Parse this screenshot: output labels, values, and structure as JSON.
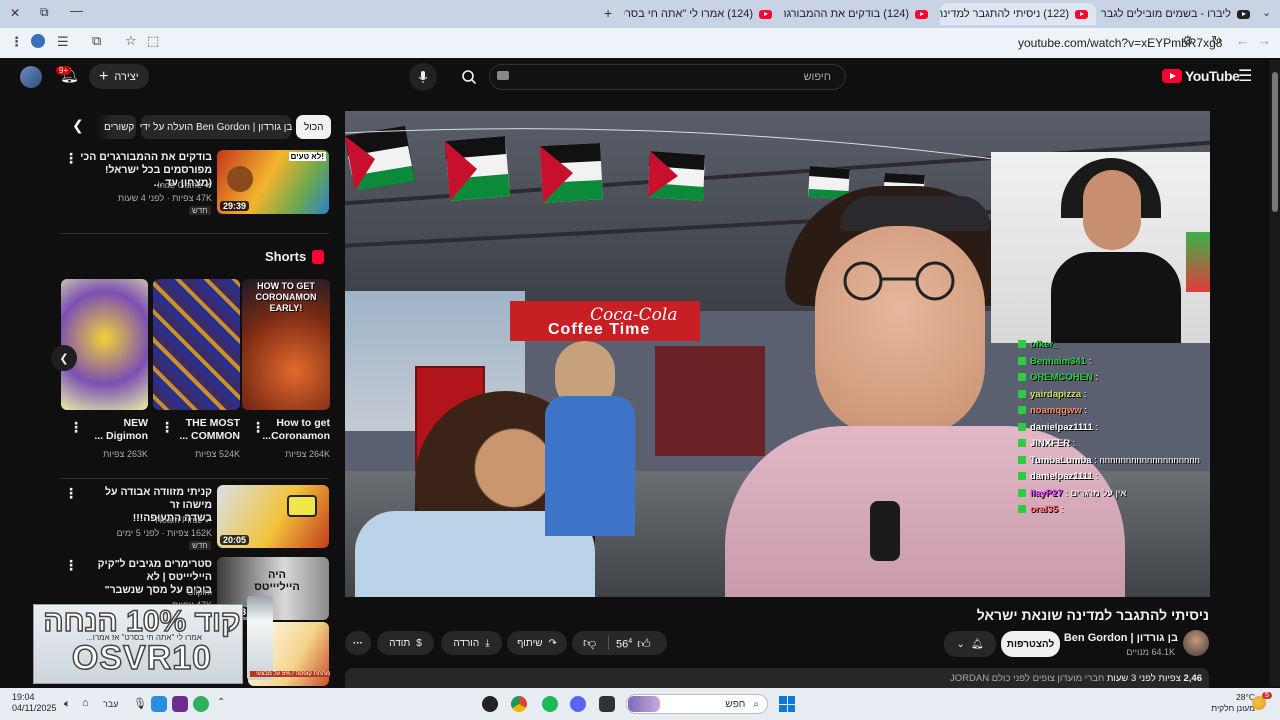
{
  "browser": {
    "tabs": [
      {
        "label": "ליברו - בשמים מובילים לגבר ול..."
      },
      {
        "label": "(122) ניסיתי להתגבר למדינה ש..."
      },
      {
        "label": "(124) בודקים את ההמבורגרים..."
      },
      {
        "label": "(124) אמרו לי \"אתה חי בסרט\"..."
      }
    ],
    "url": "youtube.com/watch?v=xEYPmbR7xg8"
  },
  "header": {
    "logo": "YouTube",
    "search_placeholder": "חיפוש",
    "create_label": "יצירה",
    "notif_count": "9+"
  },
  "filters": [
    "הכול",
    "הועלה על ידי Ben Gordon | בן גורדון",
    "קשורים"
  ],
  "sidebar": {
    "top_video": {
      "title_line1": "בודקים את ההמבורגרים הכי",
      "title_line2": "מפורסמים בכל ישראל! (מצחון עד ...",
      "channel": "Inde Game",
      "meta": "47K צפיות · לפני 4 שעות",
      "badge": "חדש",
      "duration": "29:39",
      "thumb_text": "לא טעים!"
    },
    "shorts_heading": "Shorts",
    "shorts": [
      {
        "title_line1": "How to get",
        "title_line2": "Coronamon...",
        "views": "264K צפיות",
        "thumb_text": "HOW TO GET CORONAMON EARLY!"
      },
      {
        "title_line1": "THE MOST",
        "title_line2": "COMMON ...",
        "views": "524K צפיות"
      },
      {
        "title_line1": "NEW",
        "title_line2": "Digimon ...",
        "views": "263K צפיות"
      }
    ],
    "video2": {
      "title_line1": "קניתי מזוודה אבודה על מישהו זר",
      "title_line2": "בשדה התעופה!!!",
      "channel": "Noam Firuz",
      "meta": "162K צפיות · לפני 5 ימים",
      "badge": "חדש",
      "duration": "20:05"
    },
    "video3": {
      "title_line1": "סטרימרים מגיבים ל\"קיק הייליייטס | לא",
      "title_line2": "בוכים על מסך שנשבר\"",
      "channel": "Clipim",
      "meta": "47K צפיות",
      "duration": "17:08",
      "thumb_text": "היה הייליייטס"
    }
  },
  "ad_overlay": {
    "line1": "קוד 10% הנחה",
    "line2": "OSVR10",
    "sub": "אמרו לי \"אתה חי בסרט\" אז אמרו...",
    "small": "מתחת קופסה / 5% על מבצעי"
  },
  "video": {
    "sign": "Coffee Time",
    "brand": "Coca-Cola",
    "chat": [
      {
        "name": "ofker_",
        "msg": ""
      },
      {
        "name": "Benhaim341",
        "msg": ":"
      },
      {
        "name": "OREMCOHEN",
        "msg": ":"
      },
      {
        "name": "yairdapizza",
        "msg": ":"
      },
      {
        "name": "noamqgww",
        "msg": ":"
      },
      {
        "name": "danielpaz1111",
        "msg": ":"
      },
      {
        "name": "JINXFER",
        "msg": ":"
      },
      {
        "name": "TumbaLumba",
        "msg": ": nnnnnnnnnnnnnnnnnnn"
      },
      {
        "name": "danielpaz1111",
        "msg": ":"
      },
      {
        "name": "ilayP27",
        "msg": ": אין על מרגרים"
      },
      {
        "name": "oral35",
        "msg": ":"
      }
    ]
  },
  "video_info": {
    "title": "ניסיתי להתגבר למדינה שונאת ישראל",
    "channel": "Ben Gordon | בן גורדון",
    "subs": "64.1K מנויים",
    "subscribe": "להצטרפות",
    "likes": "56",
    "likes_sup": "4",
    "share": "שיתוף",
    "download": "הורדה",
    "thanks": "תודה",
    "views": "2,46",
    "meta": "צפיות לפני 3 שעות",
    "members_note": "חברי מועדון צופים לפני כולם",
    "tag": "JORDAN"
  },
  "taskbar": {
    "search": "חפש",
    "weather_temp": "28°C",
    "weather_desc": "מעונן חלקית",
    "time": "19:04",
    "date": "04/11/2025",
    "lang": "עבר",
    "notif": "5"
  },
  "colors": {
    "accent": "#ff0033",
    "chat_green": "#2ecc40"
  }
}
